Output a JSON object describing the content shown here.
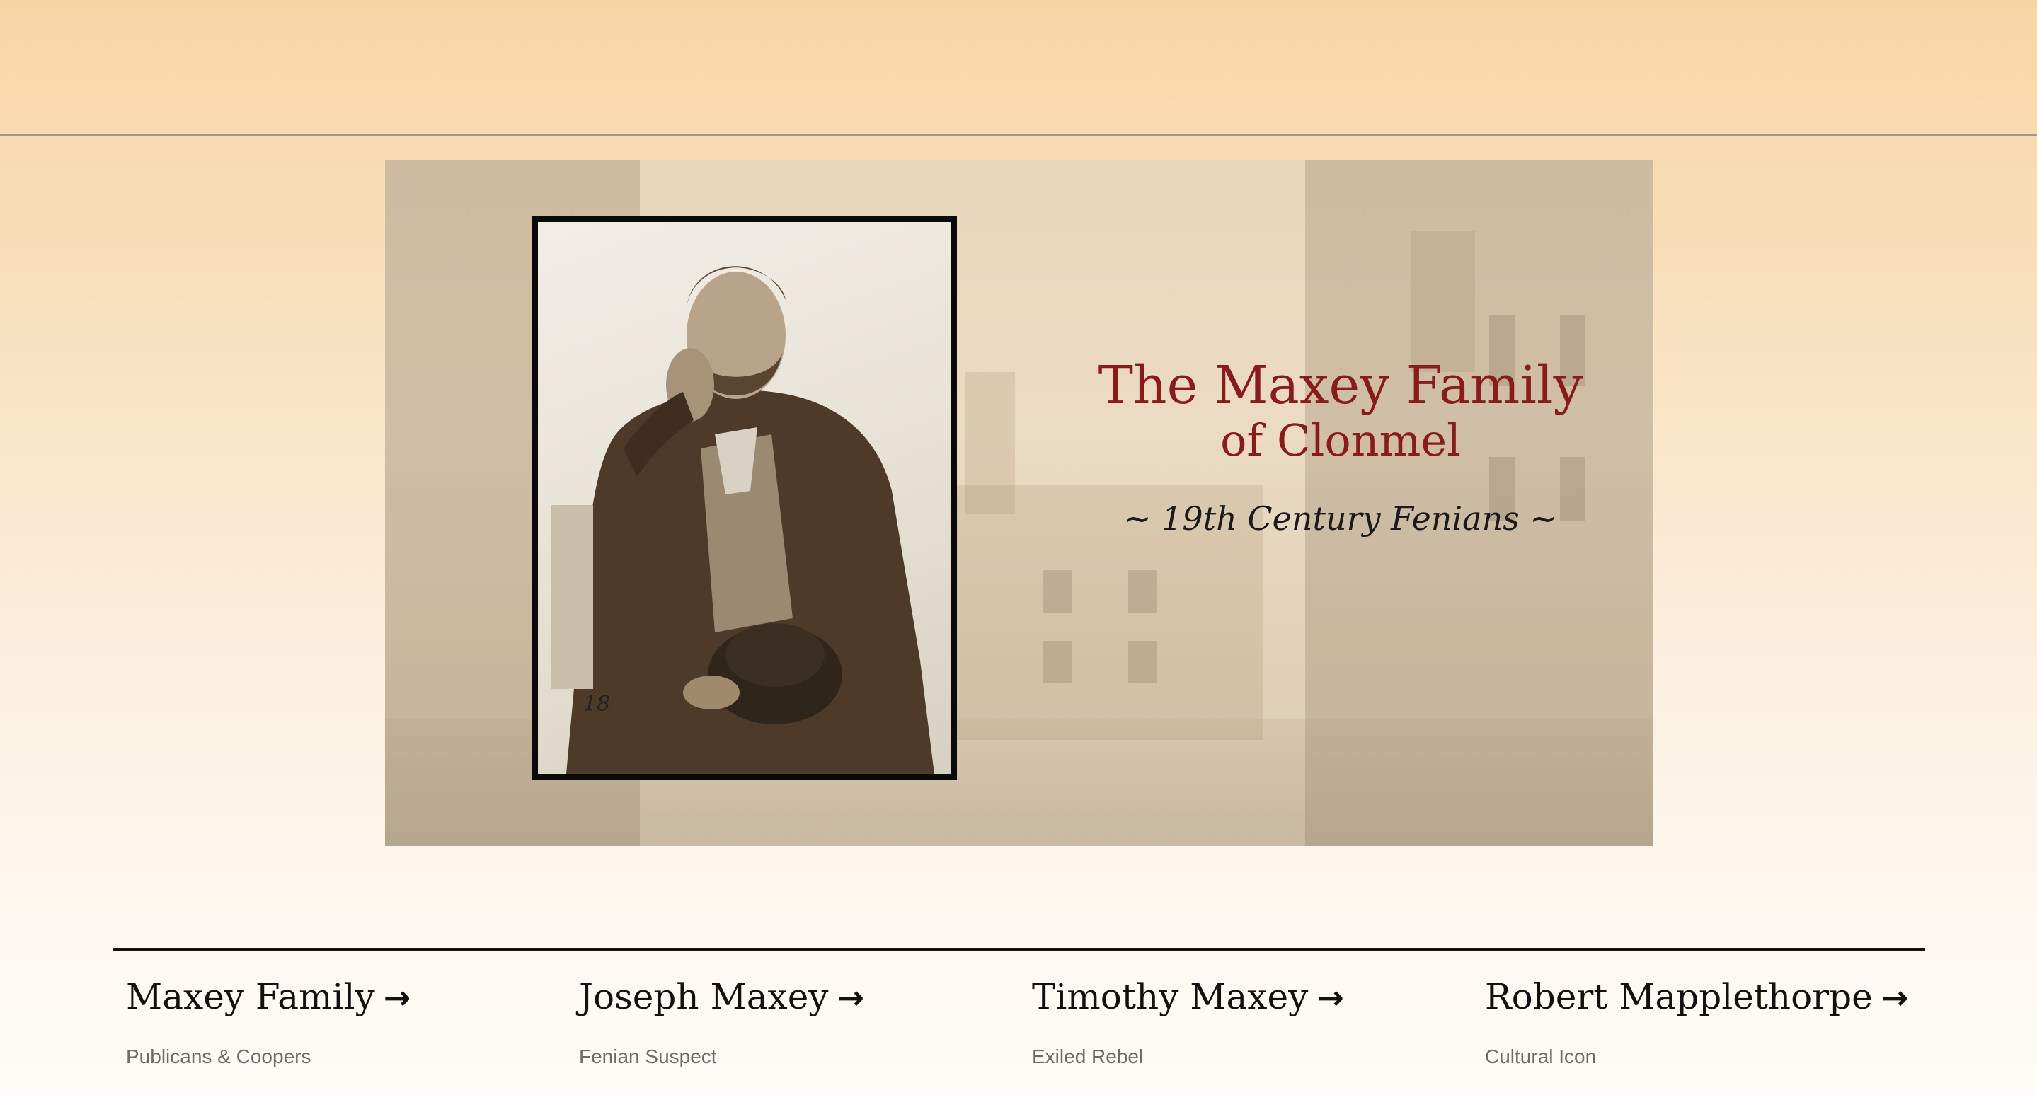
{
  "hero": {
    "title": "The Maxey Family",
    "subtitle": "of Clonmel",
    "tagline": "~ 19th Century Fenians ~",
    "photo_number": "18"
  },
  "cards": [
    {
      "title": "Maxey Family",
      "arrow": "→",
      "subtitle": "Publicans & Coopers"
    },
    {
      "title": "Joseph Maxey",
      "arrow": "→",
      "subtitle": "Fenian Suspect"
    },
    {
      "title": "Timothy Maxey",
      "arrow": "→",
      "subtitle": "Exiled Rebel"
    },
    {
      "title": "Robert Mapplethorpe",
      "arrow": "→",
      "subtitle": "Cultural Icon"
    }
  ],
  "colors": {
    "title": "#8b1a1a",
    "background_top": "#f7d6a6",
    "background_bottom": "#fefcf8"
  }
}
